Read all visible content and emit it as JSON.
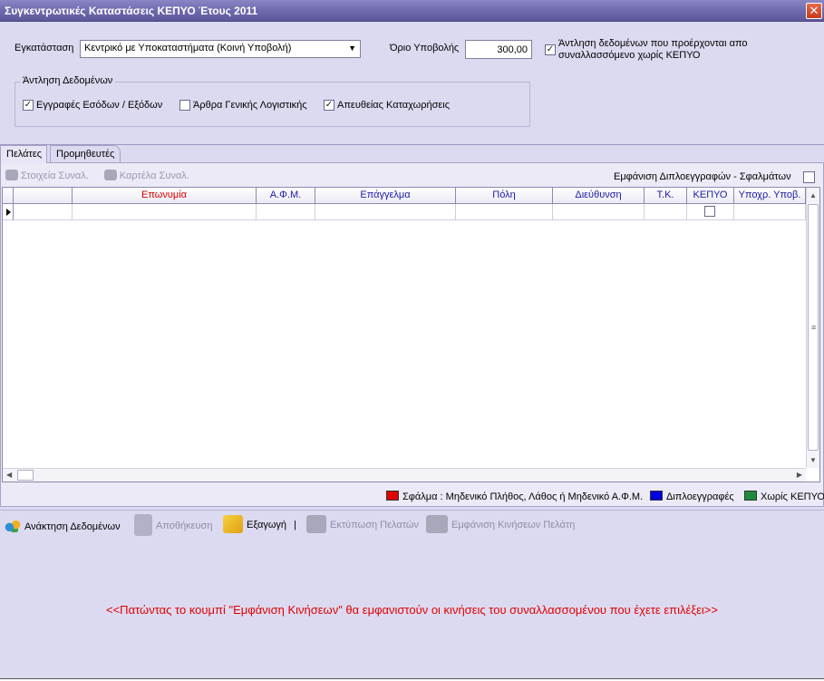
{
  "window": {
    "title": "Συγκεντρωτικές Καταστάσεις ΚΕΠΥΟ Έτους 2011",
    "close_glyph": "✕"
  },
  "filters": {
    "installation_label": "Εγκατάσταση",
    "installation_value": "Κεντρικό με Υποκαταστήματα (Κοινή Υποβολή)",
    "limit_label": "Όριο Υποβολής",
    "limit_value": "300,00",
    "fetch_without_kepyo_label_line1": "Άντληση δεδομένων που προέρχονται απο",
    "fetch_without_kepyo_label_line2": "συναλλασσόμενο χωρίς ΚΕΠΥΟ",
    "fetch_without_kepyo_checked": true
  },
  "data_source": {
    "legend": "Άντληση Δεδομένων",
    "options": [
      {
        "label": "Εγγραφές Εσόδων / Εξόδων",
        "checked": true
      },
      {
        "label": "Άρθρα Γενικής Λογιστικής",
        "checked": false
      },
      {
        "label": "Απευθείας Καταχωρήσεις",
        "checked": true
      }
    ]
  },
  "tabs": [
    {
      "label": "Πελάτες",
      "active": true
    },
    {
      "label": "Προμηθευτές",
      "active": false
    }
  ],
  "grid_toolbar": {
    "details_label": "Στοιχεία Συναλ.",
    "card_label": "Καρτέλα Συναλ.",
    "show_duplicates_label": "Εμφάνιση Διπλοεγγραφών - Σφαλμάτων",
    "show_duplicates_checked": false
  },
  "grid": {
    "columns": [
      "Επωνυμία",
      "Α.Φ.Μ.",
      "Επάγγελμα",
      "Πόλη",
      "Διεύθυνση",
      "Τ.Κ.",
      "ΚΕΠΥΟ",
      "Υποχρ. Υποβ."
    ]
  },
  "legend": {
    "error": {
      "label": "Σφάλμα : Μηδενικό Πλήθος, Λάθος ή Μηδενικό Α.Φ.Μ.",
      "color": "#e00000"
    },
    "duplicate": {
      "label": "Διπλοεγγραφές",
      "color": "#0000e0"
    },
    "no_kepyo": {
      "label": "Χωρίς ΚΕΠΥΟ",
      "color": "#1f8a3c"
    }
  },
  "actions": {
    "fetch": "Ανάκτηση Δεδομένων",
    "save": "Αποθήκευση",
    "export": "Εξαγωγή",
    "separator": "|",
    "print": "Εκτύπωση Πελατών",
    "show_movements": "Εμφάνιση Κινήσεων Πελάτη"
  },
  "message": "<<Πατώντας το κουμπί \"Εμφάνιση Κινήσεων\" θα εμφανιστούν οι κινήσεις του συναλλασσομένου που έχετε επιλέξει>>"
}
